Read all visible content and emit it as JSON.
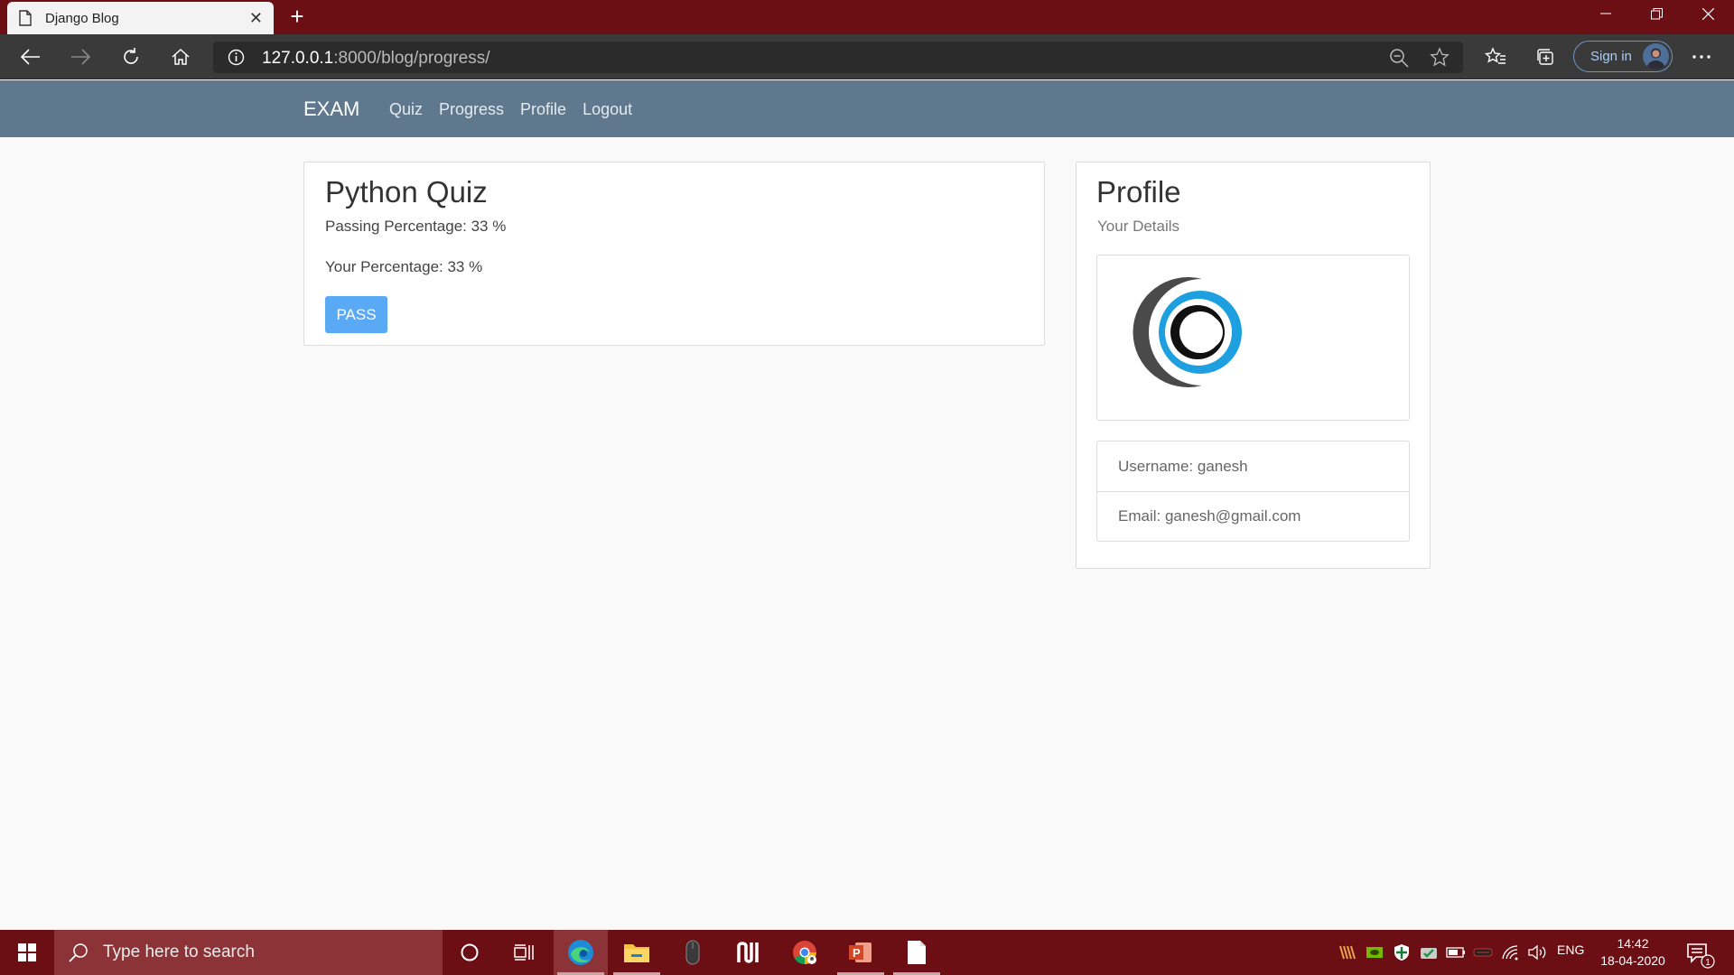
{
  "browser": {
    "tab_title": "Django Blog",
    "url_host": "127.0.0.1",
    "url_rest": ":8000/blog/progress/",
    "signin_label": "Sign in"
  },
  "nav": {
    "brand": "EXAM",
    "links": [
      "Quiz",
      "Progress",
      "Profile",
      "Logout"
    ]
  },
  "quiz": {
    "title": "Python Quiz",
    "passing": "Passing Percentage: 33 %",
    "yours": "Your Percentage: 33 %",
    "result": "PASS"
  },
  "profile": {
    "title": "Profile",
    "subtitle": "Your Details",
    "username": "Username: ganesh",
    "email": "Email: ganesh@gmail.com"
  },
  "taskbar": {
    "search_placeholder": "Type here to search",
    "language": "ENG",
    "time": "14:42",
    "date": "18-04-2020",
    "notification_count": "1"
  },
  "colors": {
    "titlebar": "#6b0f14",
    "site_nav": "#5f788e",
    "pass_button": "#5aa9f5",
    "logo_dark": "#4a4a4a",
    "logo_blue": "#1ea0e0"
  }
}
